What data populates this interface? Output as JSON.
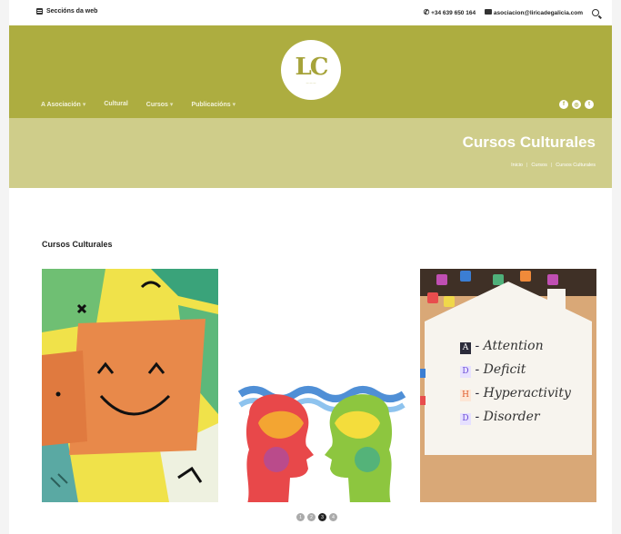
{
  "topbar": {
    "sections_label": "Seccións da web",
    "phone": "+34 639 650 164",
    "email": "asociacion@liricadegalicia.com"
  },
  "logo": {
    "mark": "LC"
  },
  "nav": {
    "items": [
      {
        "label": "A Asociación",
        "has_dropdown": true
      },
      {
        "label": "Cultural",
        "has_dropdown": false
      },
      {
        "label": "Cursos",
        "has_dropdown": true
      },
      {
        "label": "Publicacións",
        "has_dropdown": true
      }
    ],
    "social": [
      "f",
      "◎",
      "t"
    ]
  },
  "banner": {
    "title": "Cursos Culturales",
    "breadcrumbs": [
      "Inicio",
      "Cursos",
      "Cursos Culturales"
    ]
  },
  "section": {
    "title": "Cursos Culturales"
  },
  "cards": [
    {
      "image": "smiley-paper-collage"
    },
    {
      "image": "colorful-heads-facing"
    },
    {
      "image": "adhd-blocks-board",
      "lines": [
        {
          "letter": "A",
          "word": "Attention"
        },
        {
          "letter": "D",
          "word": "Deficit"
        },
        {
          "letter": "H",
          "word": "Hyperactivity"
        },
        {
          "letter": "D",
          "word": "Disorder"
        }
      ]
    }
  ],
  "pager": {
    "dots": [
      "1",
      "2",
      "3",
      "4"
    ],
    "active": 3
  },
  "colors": {
    "header": "#adad40",
    "banner": "#cfcd8a"
  }
}
